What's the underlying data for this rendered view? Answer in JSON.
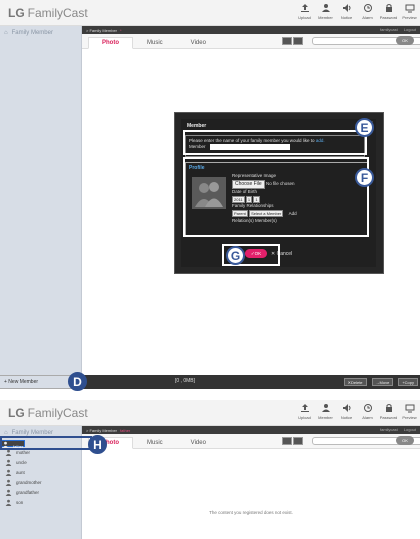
{
  "app": {
    "brand_lg": "LG",
    "brand_name": "FamilyCast"
  },
  "toolbar": {
    "icons": [
      {
        "name": "upload-icon",
        "label": "Upload"
      },
      {
        "name": "member-icon",
        "label": "Member"
      },
      {
        "name": "notice-icon",
        "label": "Notice"
      },
      {
        "name": "alarm-icon",
        "label": "Alarm"
      },
      {
        "name": "password-icon",
        "label": "Password"
      },
      {
        "name": "preview-icon",
        "label": "Preview"
      }
    ]
  },
  "sidebar": {
    "title": "Family Member"
  },
  "breadcrumb": {
    "root": "> Family Member",
    "sub_a": "*",
    "sub_b": "father"
  },
  "account": {
    "user": "familycast",
    "logout": "Logout"
  },
  "tabs": [
    "Photo",
    "Music",
    "Video"
  ],
  "search": {
    "ok": "OK"
  },
  "dialog": {
    "title": "Member",
    "close": "x",
    "prompt_text": "Please enter the name of your family member you would like to",
    "prompt_link": "add.",
    "member_label": "Member",
    "profile_title": "Profile",
    "rep_image_label": "Representative Image",
    "choose_file": "Choose File",
    "no_file": "No file chosen",
    "dob_label": "Date of Birth",
    "dob_year": "2011",
    "dob_month": "1",
    "dob_day": "1",
    "relationship_label": "Family Relationships",
    "rel_parent": "Parent",
    "rel_select": "Select a Member",
    "rel_add": "Add",
    "relation_members": "Relation(s) Member(s)",
    "ok": "OK",
    "cancel": "Cancel"
  },
  "bottom": {
    "new_member": "+ New Member",
    "count": "[0 , 0MB]",
    "delete": "Delete",
    "move": "Move",
    "copy": "Copy"
  },
  "members": [
    "father",
    "mother",
    "uncle",
    "aunt",
    "grandmother",
    "grandfather",
    "son"
  ],
  "empty_message": "The content you registered does not exist.",
  "callouts": {
    "d": "D",
    "e": "E",
    "f": "F",
    "g": "G",
    "h": "H"
  },
  "colors": {
    "accent_pink": "#e2206a",
    "sidebar_bg": "#d7dde6",
    "callout_blue": "#2f4f8f"
  }
}
